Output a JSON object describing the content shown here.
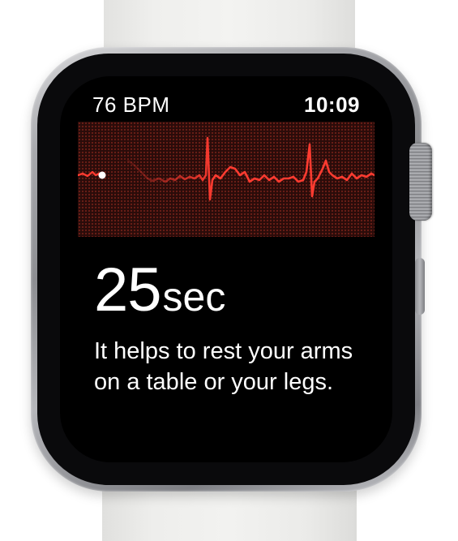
{
  "watch": {
    "status_bar": {
      "heart_rate": "76 BPM",
      "time": "10:09"
    },
    "ecg": {
      "trace_color": "#ff3b30",
      "dot_color": "#ffffff",
      "grid_color": "#2a0c0a"
    },
    "countdown": {
      "value": "25",
      "unit": "sec"
    },
    "instruction": {
      "text": "It helps to rest your arms on a table or your legs."
    }
  }
}
